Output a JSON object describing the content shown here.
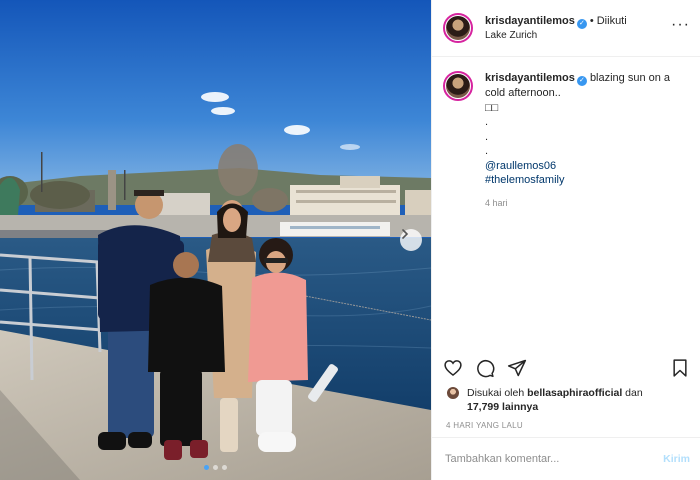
{
  "header": {
    "username": "krisdayantilemos",
    "separator": "•",
    "follow_label": "Diikuti",
    "location": "Lake Zurich",
    "more_icon": "more-options-icon"
  },
  "caption": {
    "username": "krisdayantilemos",
    "text_line1": "blazing sun on a",
    "text_line2": "cold afternoon..",
    "emoji_line": "□□",
    "dot1": ".",
    "dot2": ".",
    "dot3": ".",
    "mention": "@raullemos06",
    "hashtag": "#thelemosfamily",
    "age": "4 hari"
  },
  "media": {
    "carousel_count": 3,
    "active_index": 0,
    "next_icon": "chevron-right-icon"
  },
  "actions": {
    "icons": [
      "heart-icon",
      "comment-icon",
      "share-icon",
      "bookmark-icon"
    ]
  },
  "likes": {
    "prefix": "Disukai oleh",
    "liker": "bellasaphiraofficial",
    "conj": "dan",
    "count": "17,799",
    "suffix": "lainnya"
  },
  "date": "4 HARI YANG LALU",
  "comment_box": {
    "placeholder": "Tambahkan komentar...",
    "post_label": "Kirim"
  },
  "colors": {
    "link": "#00376b",
    "verified": "#3897f0",
    "post_disabled": "#b2dffc",
    "muted": "#8e8e8e"
  }
}
